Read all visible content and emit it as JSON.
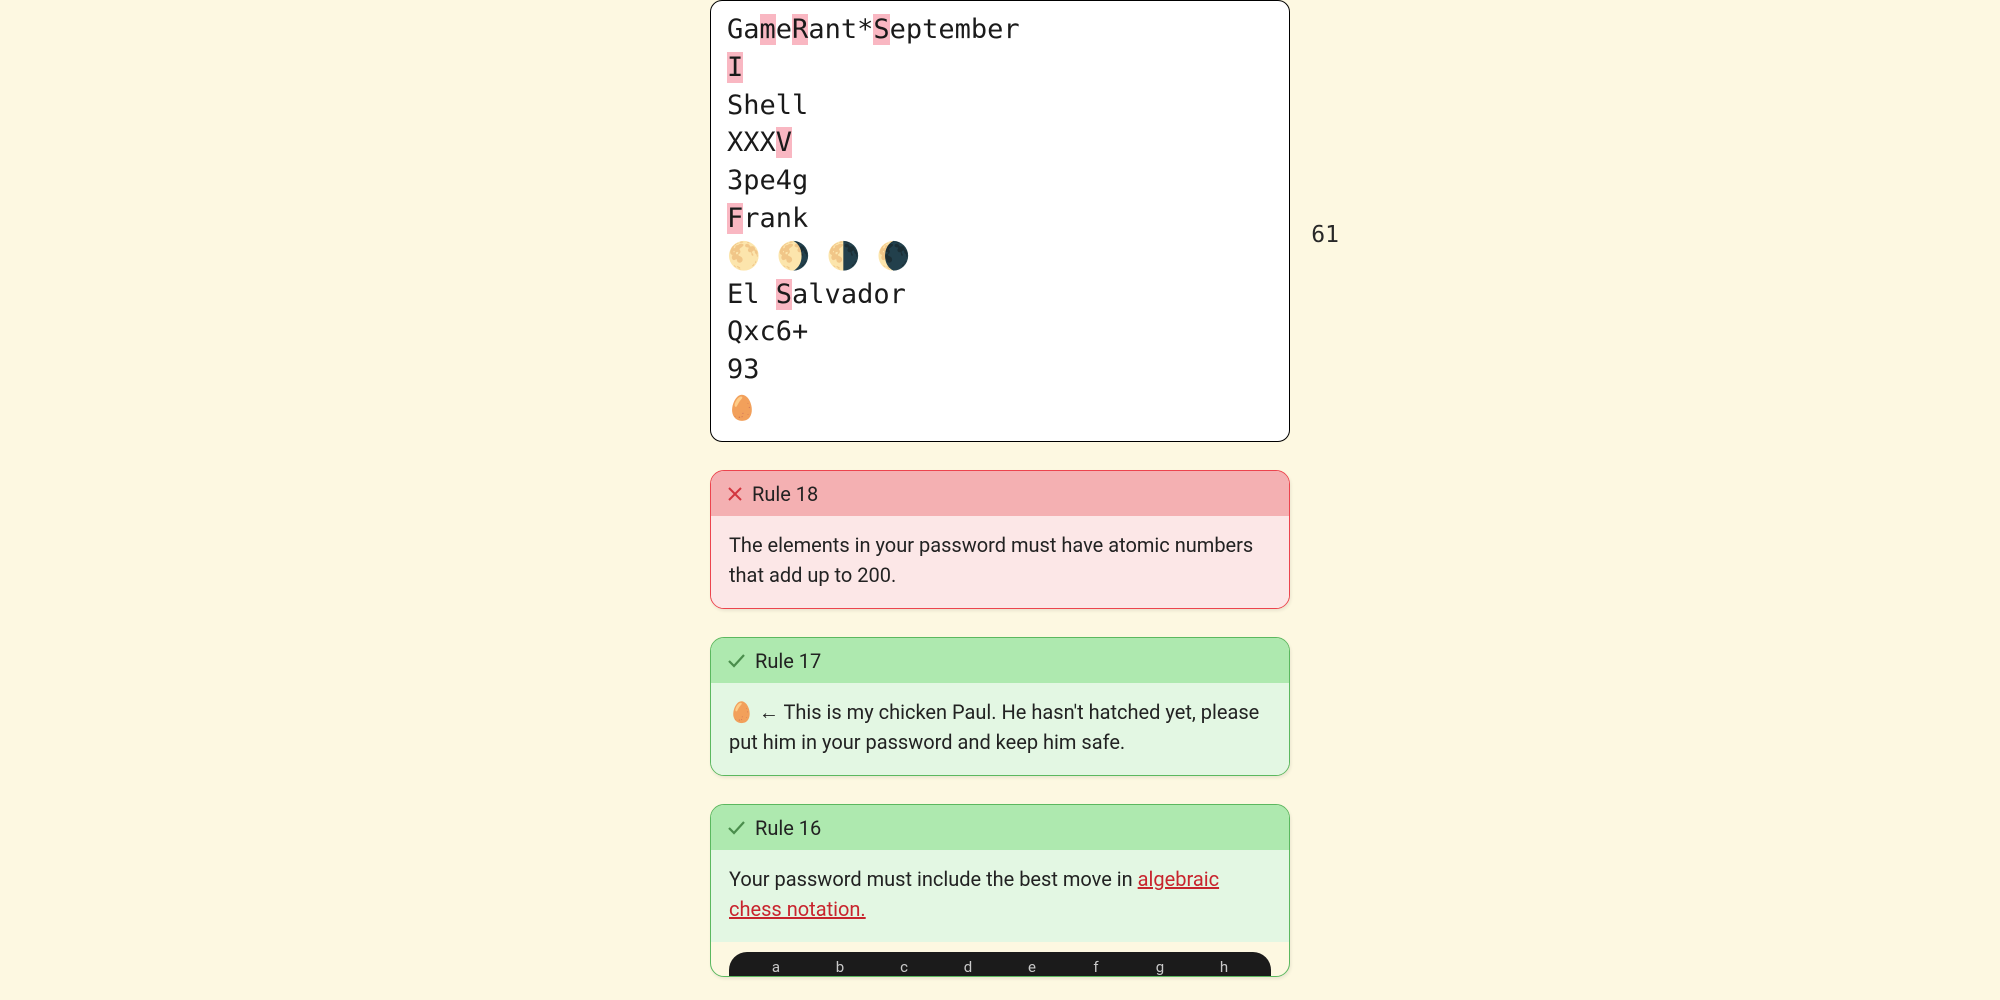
{
  "char_count": "61",
  "password": {
    "line1": {
      "segments": [
        {
          "t": "Ga",
          "hl": false
        },
        {
          "t": "m",
          "hl": true
        },
        {
          "t": "e",
          "hl": false
        },
        {
          "t": "R",
          "hl": true
        },
        {
          "t": "ant*",
          "hl": false
        },
        {
          "t": "S",
          "hl": true
        },
        {
          "t": "eptember",
          "hl": false
        }
      ]
    },
    "line2": {
      "segments": [
        {
          "t": "I",
          "hl": true
        }
      ]
    },
    "line3": {
      "segments": [
        {
          "t": "Shell",
          "hl": false
        }
      ]
    },
    "line4": {
      "segments": [
        {
          "t": "XXX",
          "hl": false
        },
        {
          "t": "V",
          "hl": true
        }
      ]
    },
    "line5": {
      "segments": [
        {
          "t": "3pe4g",
          "hl": false
        }
      ]
    },
    "line6": {
      "segments": [
        {
          "t": "F",
          "hl": true
        },
        {
          "t": "rank",
          "hl": false
        }
      ]
    },
    "line7_moons": "🌕 🌖 🌗 🌘",
    "line8": {
      "segments": [
        {
          "t": "El ",
          "hl": false
        },
        {
          "t": "S",
          "hl": true
        },
        {
          "t": "alvador",
          "hl": false
        }
      ]
    },
    "line9": {
      "segments": [
        {
          "t": "Qxc6+",
          "hl": false
        }
      ]
    },
    "line10": {
      "segments": [
        {
          "t": "93",
          "hl": false
        }
      ]
    },
    "line11_egg": "🥚"
  },
  "rules": {
    "r18": {
      "label": "Rule 18",
      "body": "The elements in your password must have atomic numbers that add up to 200."
    },
    "r17": {
      "label": "Rule 17",
      "egg": "🥚",
      "body_after_egg": " ← This is my chicken Paul. He hasn't hatched yet, please put him in your password and keep him safe."
    },
    "r16": {
      "label": "Rule 16",
      "body_before_link": "Your password must include the best move in ",
      "link_text": "algebraic chess notation.",
      "files": [
        "a",
        "b",
        "c",
        "d",
        "e",
        "f",
        "g",
        "h"
      ]
    }
  }
}
